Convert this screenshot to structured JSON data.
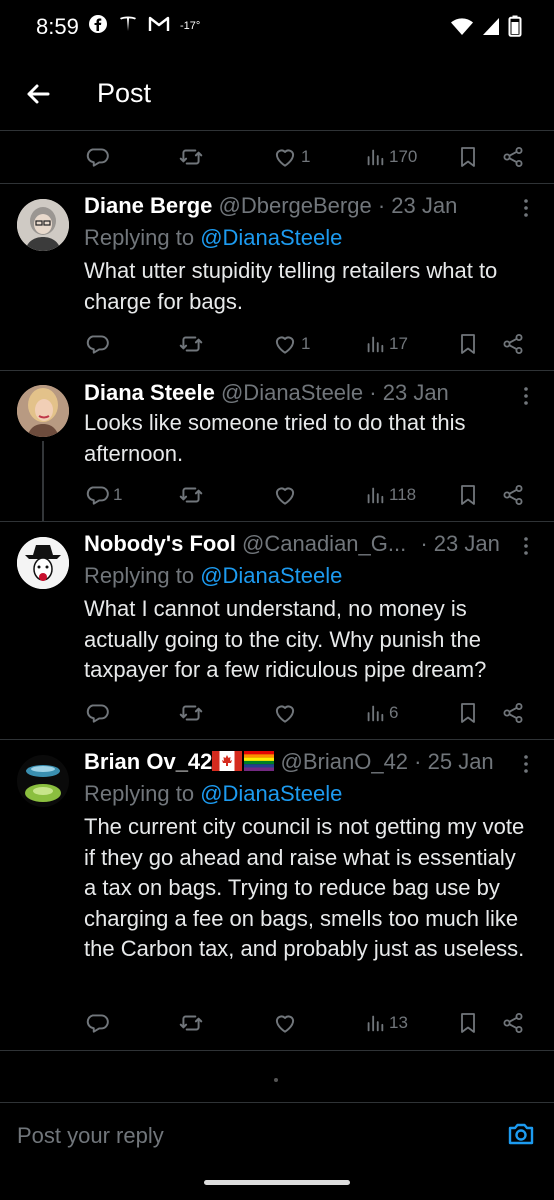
{
  "status_bar": {
    "time": "8:59",
    "temperature": "-17°"
  },
  "header": {
    "title": "Post"
  },
  "top_actions": {
    "replies": "",
    "reposts": "",
    "likes": "1",
    "views": "170"
  },
  "posts": [
    {
      "name": "Diane Berge",
      "handle": "@DbergeBerge",
      "date": "· 23 Jan",
      "replying_prefix": "Replying to ",
      "replying_to": "@DianaSteele",
      "text": "What utter stupidity telling retailers what to charge for bags.",
      "actions": {
        "replies": "",
        "reposts": "",
        "likes": "1",
        "views": "17"
      }
    },
    {
      "name": "Diana Steele",
      "handle": "@DianaSteele",
      "date": "· 23 Jan",
      "replying_prefix": "",
      "replying_to": "",
      "text": "Looks like someone tried to do that this afternoon.",
      "actions": {
        "replies": "1",
        "reposts": "",
        "likes": "",
        "views": "118"
      }
    },
    {
      "name": "Nobody's Fool",
      "handle": "@Canadian_G...",
      "date": "· 23 Jan",
      "replying_prefix": "Replying to ",
      "replying_to": "@DianaSteele",
      "text": "What I cannot understand, no money is actually going to the city. Why punish the taxpayer for a few ridiculous pipe dream?",
      "actions": {
        "replies": "",
        "reposts": "",
        "likes": "",
        "views": "6"
      }
    },
    {
      "name": "Brian Ov_42",
      "handle": "@BrianO_42",
      "date": "· 25 Jan",
      "replying_prefix": "Replying to ",
      "replying_to": "@DianaSteele",
      "text": "The current city council is not getting my vote if they go ahead and raise what is essentialy a tax on bags. Trying to reduce bag use by charging a fee on bags, smells too much like the Carbon tax, and probably just as useless.",
      "actions": {
        "replies": "",
        "reposts": "",
        "likes": "",
        "views": "13"
      }
    }
  ],
  "reply_bar": {
    "placeholder": "Post your reply"
  },
  "colors": {
    "accent": "#1d9bf0",
    "muted": "#71767b",
    "background": "#000000",
    "divider": "#2f3336"
  }
}
